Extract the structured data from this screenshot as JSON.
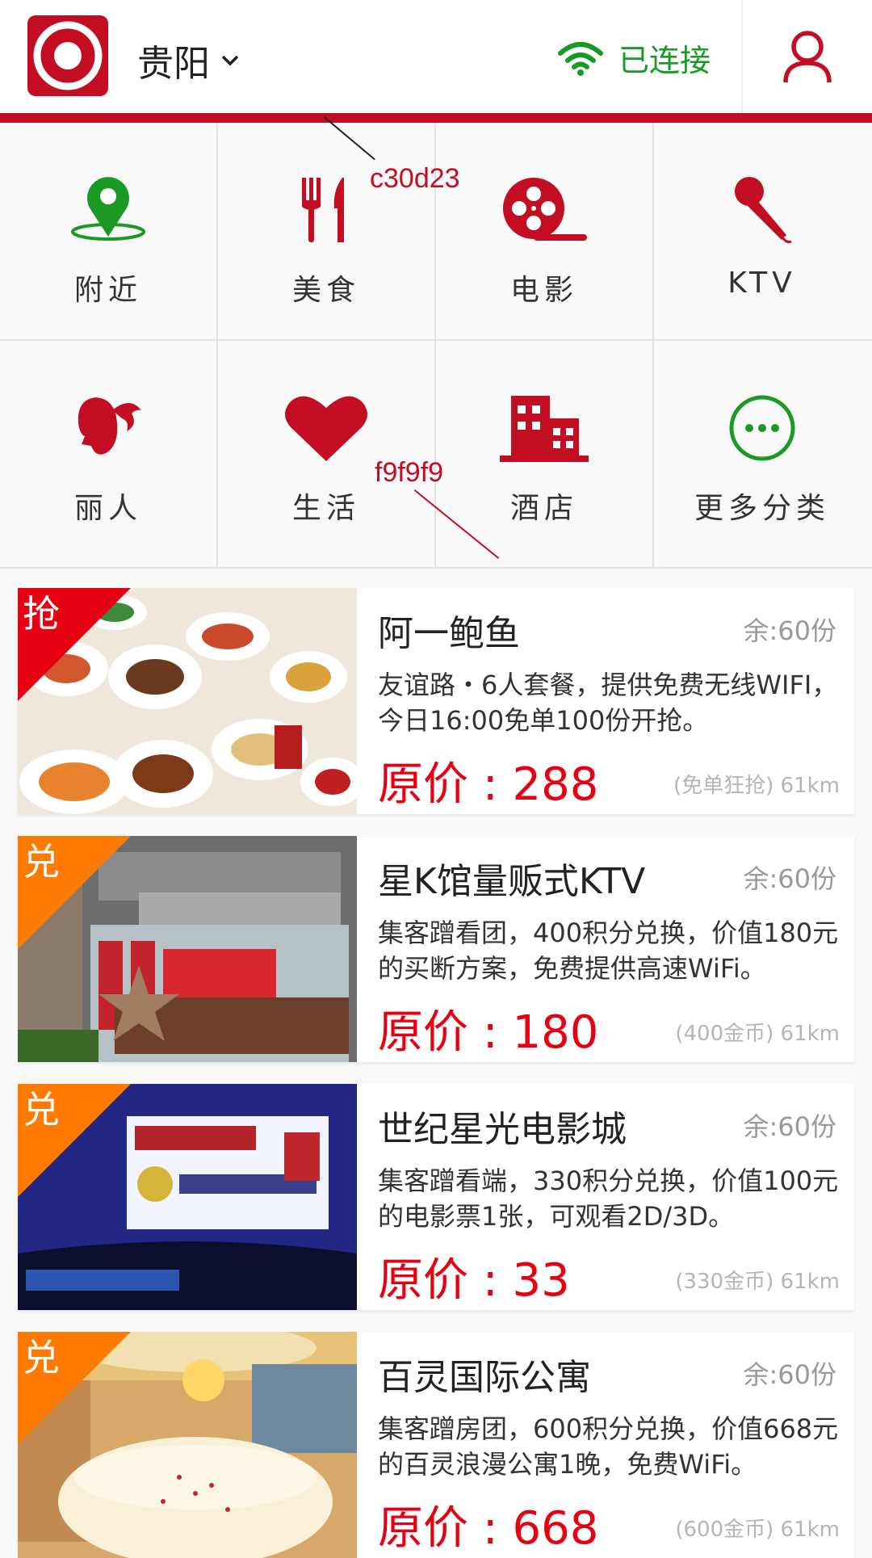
{
  "header": {
    "city": "贵阳",
    "wifi_status": "已连接",
    "brand_color": "#c30d23",
    "wifi_color": "#159a25"
  },
  "annotations": [
    {
      "text": "c30d23"
    },
    {
      "text": "f9f9f9"
    }
  ],
  "categories": [
    {
      "label": "附近",
      "icon": "location-pin-icon",
      "color": "#1a9a22"
    },
    {
      "label": "美食",
      "icon": "fork-knife-icon",
      "color": "#c30d23"
    },
    {
      "label": "电影",
      "icon": "film-reel-icon",
      "color": "#c30d23"
    },
    {
      "label": "KTV",
      "icon": "microphone-icon",
      "color": "#c30d23"
    },
    {
      "label": "丽人",
      "icon": "woman-head-icon",
      "color": "#c30d23"
    },
    {
      "label": "生活",
      "icon": "heart-icon",
      "color": "#c30d23"
    },
    {
      "label": "酒店",
      "icon": "hotel-building-icon",
      "color": "#c30d23"
    },
    {
      "label": "更多分类",
      "icon": "more-dots-icon",
      "color": "#1a9a22"
    }
  ],
  "deals": [
    {
      "badge": "抢",
      "badge_color": "#e60012",
      "title": "阿一鲍鱼",
      "stock": "余:60份",
      "desc": "友谊路・6人套餐，提供免费无线WIFI，今日16:00免单100份开抢。",
      "price_label": "原价 : ",
      "price": "288",
      "meta": "(免单狂抢) 61km",
      "image": "seafood-banquet-photo"
    },
    {
      "badge": "兑",
      "badge_color": "#ff7a00",
      "title": "星K馆量贩式KTV",
      "stock": "余:60份",
      "desc": "集客蹭看团，400积分兑换，价值180元的买断方案，免费提供高速WiFi。",
      "price_label": "原价 : ",
      "price": "180",
      "meta": "(400金币) 61km",
      "image": "ktv-building-photo"
    },
    {
      "badge": "兑",
      "badge_color": "#ff7a00",
      "title": "世纪星光电影城",
      "stock": "余:60份",
      "desc": "集客蹭看端，330积分兑换，价值100元的电影票1张，可观看2D/3D。",
      "price_label": "原价 : ",
      "price": "33",
      "meta": "(330金币) 61km",
      "image": "cinema-hall-photo"
    },
    {
      "badge": "兑",
      "badge_color": "#ff7a00",
      "title": "百灵国际公寓",
      "stock": "余:60份",
      "desc": "集客蹭房团，600积分兑换，价值668元的百灵浪漫公寓1晚，免费WiFi。",
      "price_label": "原价 : ",
      "price": "668",
      "meta": "(600金币) 61km",
      "image": "hotel-room-photo"
    }
  ]
}
